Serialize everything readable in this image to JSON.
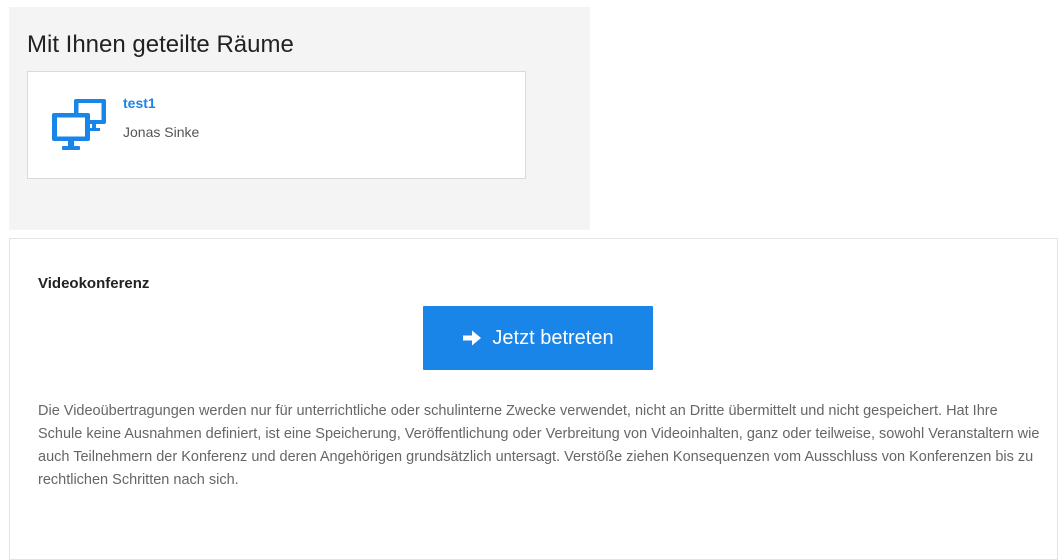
{
  "shared_rooms": {
    "heading": "Mit Ihnen geteilte Räume",
    "rooms": [
      {
        "name": "test1",
        "owner": "Jonas Sinke",
        "icon": "monitors-icon"
      }
    ]
  },
  "video_conference": {
    "title": "Videokonferenz",
    "join_button": {
      "label": "Jetzt betreten",
      "icon": "arrow-right-icon"
    },
    "disclaimer": "Die Videoübertragungen werden nur für unterrichtliche oder schulinterne Zwecke verwendet, nicht an Dritte übermittelt und nicht gespeichert. Hat Ihre Schule keine Ausnahmen definiert, ist eine Speicherung, Veröffentlichung oder Verbreitung von Videoinhalten, ganz oder teilweise, sowohl Veranstaltern wie auch Teilnehmern der Konferenz und deren Angehörigen grundsätzlich untersagt. Verstöße ziehen Konsequenzen vom Ausschluss von Konferenzen bis zu rechtlichen Schritten nach sich."
  },
  "colors": {
    "accent": "#1a85e8",
    "panel_background": "#f4f4f4",
    "text_muted": "#666666"
  }
}
